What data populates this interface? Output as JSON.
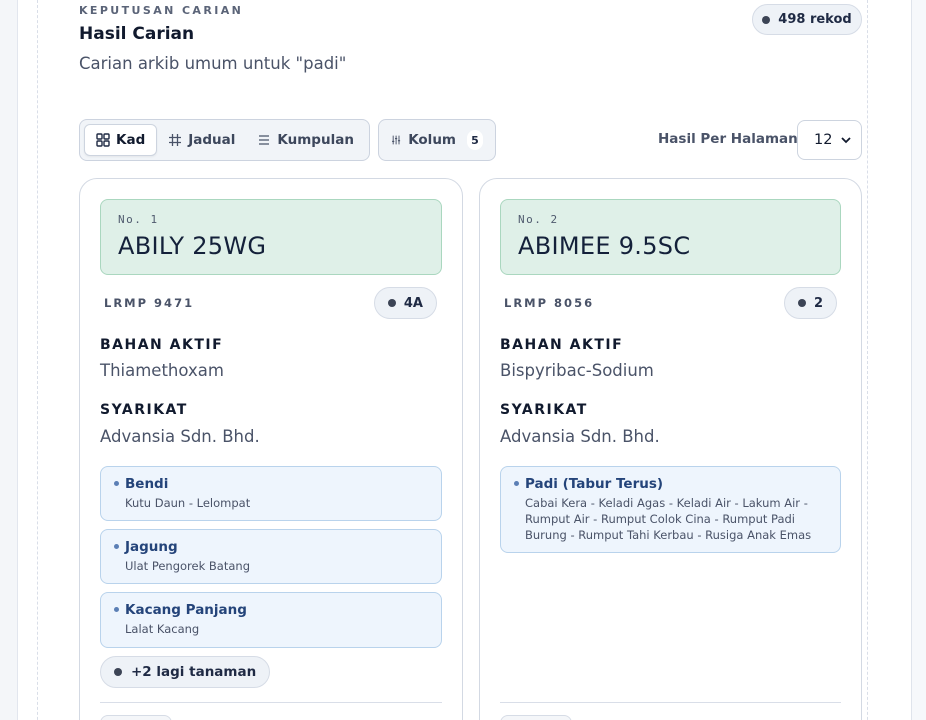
{
  "header": {
    "kicker": "KEPUTUSAN CARIAN",
    "title": "Hasil Carian",
    "subtitle": "Carian arkib umum untuk \"padi\"",
    "record_count": "498 rekod"
  },
  "toolbar": {
    "views": [
      {
        "label": "Kad",
        "icon": "grid-icon",
        "active": true
      },
      {
        "label": "Jadual",
        "icon": "table-icon",
        "active": false
      },
      {
        "label": "Kumpulan",
        "icon": "list-icon",
        "active": false
      }
    ],
    "columns_label": "Kolum",
    "columns_count": "5",
    "per_page_label": "Hasil Per Halaman",
    "per_page_value": "12"
  },
  "cards": [
    {
      "number": "No. 1",
      "name": "ABILY 25WG",
      "lrmp": "LRMP 9471",
      "group": "4A",
      "active_label": "BAHAN AKTIF",
      "active_value": "Thiamethoxam",
      "company_label": "SYARIKAT",
      "company_value": "Advansia Sdn. Bhd.",
      "crops": [
        {
          "name": "Bendi",
          "pests": "Kutu Daun - Lelompat"
        },
        {
          "name": "Jagung",
          "pests": "Ulat Pengorek Batang"
        },
        {
          "name": "Kacang Panjang",
          "pests": "Lalat Kacang"
        }
      ],
      "more": "+2 lagi tanaman"
    },
    {
      "number": "No. 2",
      "name": "ABIMEE 9.5SC",
      "lrmp": "LRMP 8056",
      "group": "2",
      "active_label": "BAHAN AKTIF",
      "active_value": "Bispyribac-Sodium",
      "company_label": "SYARIKAT",
      "company_value": "Advansia Sdn. Bhd.",
      "crops": [
        {
          "name": "Padi (Tabur Terus)",
          "pests": "Cabai Kera - Keladi Agas - Keladi Air - Lakum Air - Rumput Air - Rumput Colok Cina - Rumput Padi Burung - Rumput Tahi Kerbau - Rusiga Anak Emas"
        }
      ]
    }
  ]
}
